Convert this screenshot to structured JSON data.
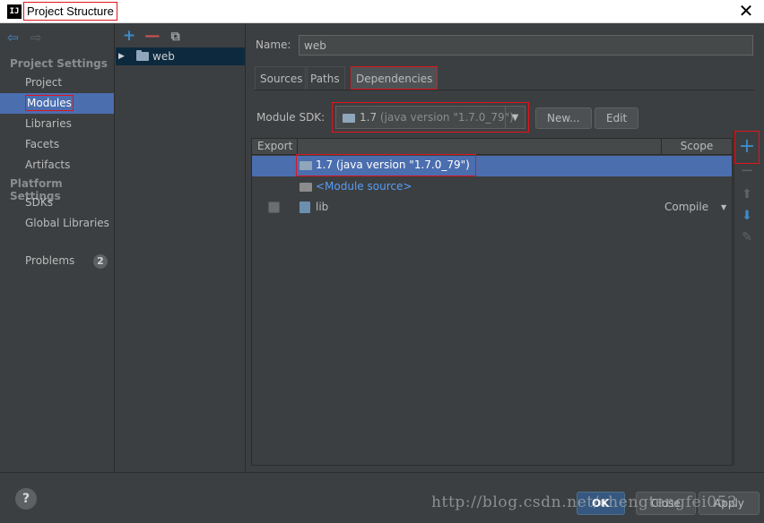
{
  "window": {
    "logo_text": "IJ",
    "title": "Project Structure",
    "close_glyph": "✕"
  },
  "left_nav": {
    "back_glyph": "⇦",
    "forward_glyph": "⇨",
    "project_settings_title": "Project Settings",
    "project_settings_items": [
      "Project",
      "Modules",
      "Libraries",
      "Facets",
      "Artifacts"
    ],
    "platform_settings_title": "Platform Settings",
    "platform_settings_items": [
      "SDKs",
      "Global Libraries"
    ],
    "problems_label": "Problems",
    "problems_count": "2",
    "selected": "Modules"
  },
  "modules_panel": {
    "toolbar": {
      "add": "+",
      "remove": "—",
      "copy": "⧉"
    },
    "tree": [
      {
        "toggle": "▶",
        "label": "web"
      }
    ]
  },
  "module": {
    "name_label": "Name:",
    "name_value": "web",
    "tabs": [
      "Sources",
      "Paths",
      "Dependencies"
    ],
    "active_tab": "Dependencies",
    "sdk_label": "Module SDK:",
    "sdk_version": "1.7",
    "sdk_detail": "(java version \"1.7.0_79\")",
    "sdk_dropdown_glyph": "▼",
    "new_button": "New...",
    "edit_button": "Edit"
  },
  "dependencies": {
    "columns": {
      "export": "Export",
      "scope": "Scope"
    },
    "rows": [
      {
        "text": "1.7 (java version \"1.7.0_79\")",
        "type": "sdk",
        "scope": ""
      },
      {
        "text": "<Module source>",
        "type": "module-source",
        "scope": ""
      },
      {
        "text": "lib",
        "type": "library",
        "scope": "Compile",
        "exported": false
      }
    ],
    "scope_arrow_glyph": "▼"
  },
  "side_toolbar": {
    "add": "+",
    "remove": "−",
    "move_up": "⬆",
    "move_down": "⬇",
    "edit": "✎"
  },
  "footer": {
    "help": "?",
    "ok": "OK",
    "close": "Close",
    "apply": "Apply",
    "watermark": "http://blog.csdn.net/chengtengfei052"
  },
  "colors": {
    "background": "#3c3f41",
    "selection": "#4b6eaf",
    "tree_selection": "#0d293e",
    "accent_blue": "#3c8ccc",
    "remove_red": "#c75450",
    "annotation_red": "#e0141e",
    "link_blue": "#589df6"
  }
}
